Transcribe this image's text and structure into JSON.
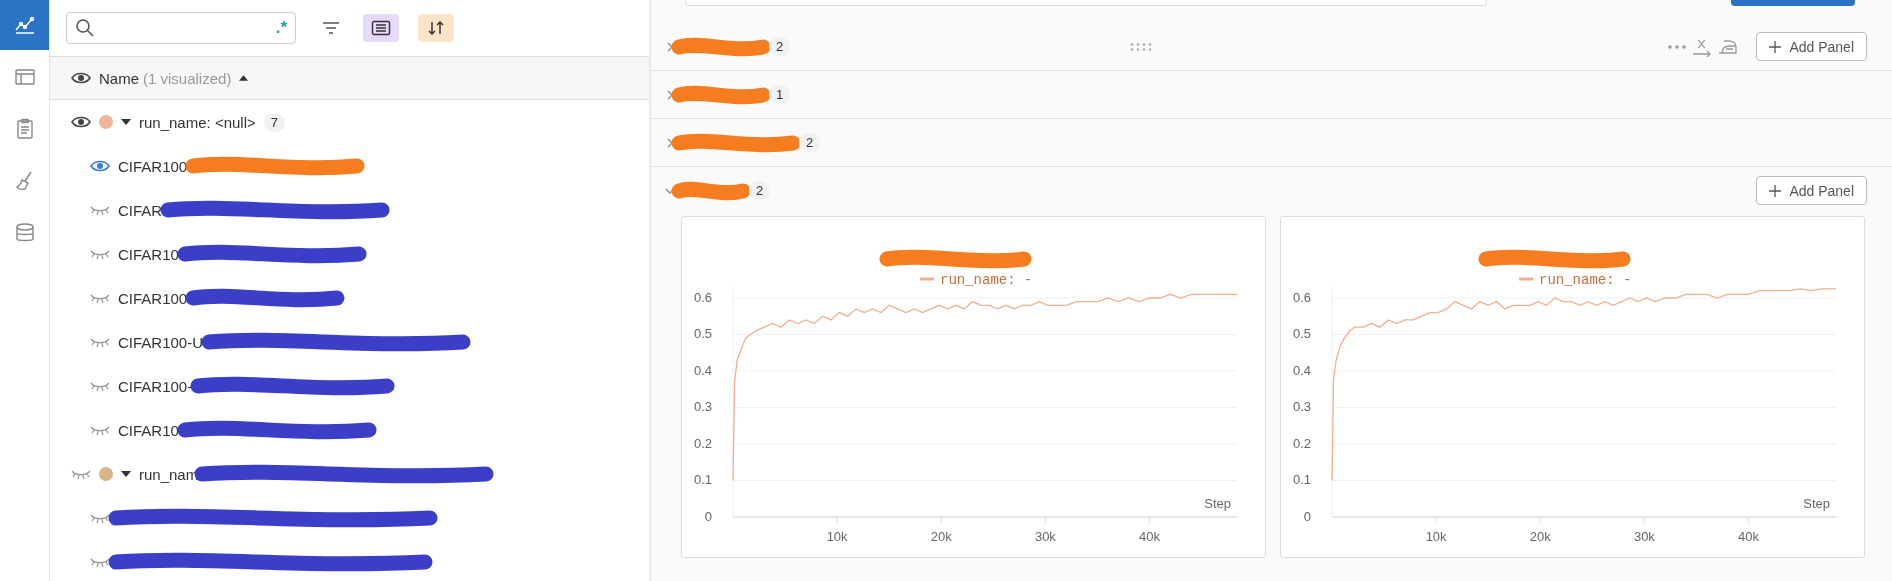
{
  "nav": [
    {
      "kind": "chart",
      "selected": true
    },
    {
      "kind": "table",
      "selected": false
    },
    {
      "kind": "report",
      "selected": false
    },
    {
      "kind": "sweep",
      "selected": false
    },
    {
      "kind": "artifact",
      "selected": false
    }
  ],
  "toolbar": {
    "regex_mark": ".*"
  },
  "runs_header": {
    "label": "Name",
    "note": "(1 visualized)"
  },
  "groups": [
    {
      "label": "run_name: <null>",
      "count": "7",
      "visible": true,
      "expanded": true,
      "color": "#f0b49a",
      "runs": [
        {
          "label": "CIFAR100",
          "visible": true,
          "scribble": {
            "color": "#f57c1f"
          }
        },
        {
          "label": "CIFAR",
          "visible": false,
          "scribble": {
            "color": "#3b3fc8"
          }
        },
        {
          "label": "CIFAR10",
          "visible": false,
          "scribble": {
            "color": "#3b3fc8"
          }
        },
        {
          "label": "CIFAR100",
          "visible": false,
          "scribble": {
            "color": "#3b3fc8"
          }
        },
        {
          "label": "CIFAR100-U",
          "visible": false,
          "scribble": {
            "color": "#3b3fc8"
          }
        },
        {
          "label": "CIFAR100-",
          "visible": false,
          "scribble": {
            "color": "#3b3fc8"
          }
        },
        {
          "label": "CIFAR10",
          "visible": false,
          "scribble": {
            "color": "#3b3fc8"
          }
        }
      ]
    },
    {
      "label": "run_nam",
      "visible": false,
      "expanded": true,
      "color": "#d9b48a",
      "scribble": {
        "color": "#3b3fc8"
      },
      "runs": [
        {
          "visible": false,
          "scribble": {
            "color": "#3b3fc8"
          }
        },
        {
          "visible": false,
          "scribble": {
            "color": "#3b3fc8"
          }
        }
      ]
    }
  ],
  "sections": [
    {
      "count": "2",
      "expanded": false,
      "hovered": true,
      "add_panel": "Add Panel",
      "scribble": {
        "color": "#f57c1f"
      }
    },
    {
      "count": "1",
      "expanded": false,
      "hovered": false,
      "scribble": {
        "color": "#f57c1f"
      }
    },
    {
      "count": "2",
      "expanded": false,
      "hovered": false,
      "scribble": {
        "color": "#f57c1f"
      }
    },
    {
      "count": "2",
      "expanded": true,
      "hovered": false,
      "add_panel": "Add Panel",
      "scribble": {
        "color": "#f57c1f"
      },
      "panels": [
        {
          "scribble": {
            "color": "#f57c1f"
          },
          "chart_data": {
            "type": "line",
            "xlabel": "Step",
            "x": [
              0,
              150,
              400,
              800,
              1200,
              1700,
              2200,
              3000,
              3800,
              4600,
              5400,
              6200,
              7000,
              7800,
              8600,
              9400,
              10200,
              11000,
              11800,
              12600,
              13400,
              14200,
              15000,
              15800,
              16600,
              17400,
              18200,
              19000,
              19800,
              20600,
              21400,
              22200,
              23000,
              23800,
              24600,
              25400,
              26200,
              27000,
              27800,
              28600,
              29400,
              30200,
              31000,
              32000,
              33000,
              34000,
              35000,
              36000,
              37000,
              38000,
              39000,
              40000,
              41000,
              42000,
              43000,
              44000,
              45000,
              46000,
              47000,
              48400
            ],
            "series": [
              {
                "name": "run_name: -",
                "color": "#f0b08f",
                "values": [
                  0.1,
                  0.37,
                  0.43,
                  0.46,
                  0.49,
                  0.5,
                  0.51,
                  0.52,
                  0.53,
                  0.52,
                  0.54,
                  0.53,
                  0.54,
                  0.53,
                  0.55,
                  0.54,
                  0.56,
                  0.55,
                  0.57,
                  0.56,
                  0.57,
                  0.56,
                  0.58,
                  0.57,
                  0.56,
                  0.57,
                  0.56,
                  0.57,
                  0.58,
                  0.57,
                  0.58,
                  0.57,
                  0.59,
                  0.58,
                  0.58,
                  0.57,
                  0.58,
                  0.57,
                  0.58,
                  0.58,
                  0.59,
                  0.58,
                  0.58,
                  0.58,
                  0.59,
                  0.59,
                  0.59,
                  0.6,
                  0.59,
                  0.6,
                  0.59,
                  0.6,
                  0.6,
                  0.61,
                  0.6,
                  0.61,
                  0.61,
                  0.61,
                  0.61,
                  0.61
                ]
              }
            ],
            "xlim": [
              0,
              48400
            ],
            "ylim": [
              0,
              0.63
            ],
            "grid": true,
            "yticks": [
              0,
              0.1,
              0.2,
              0.3,
              0.4,
              0.5,
              0.6
            ],
            "xticks": [
              {
                "value": 10000,
                "label": "10k"
              },
              {
                "value": 20000,
                "label": "20k"
              },
              {
                "value": 30000,
                "label": "30k"
              },
              {
                "value": 40000,
                "label": "40k"
              }
            ]
          }
        },
        {
          "scribble": {
            "color": "#f57c1f"
          },
          "chart_data": {
            "type": "line",
            "xlabel": "Step",
            "x": [
              0,
              150,
              400,
              800,
              1200,
              1700,
              2200,
              3000,
              3800,
              4600,
              5400,
              6200,
              7000,
              7800,
              8600,
              9400,
              10200,
              11000,
              11800,
              12600,
              13400,
              14200,
              15000,
              15800,
              16600,
              17400,
              18200,
              19000,
              19800,
              20600,
              21400,
              22200,
              23000,
              23800,
              24600,
              25400,
              26200,
              27000,
              27800,
              28600,
              29400,
              30200,
              31000,
              32000,
              33000,
              34000,
              35000,
              36000,
              37000,
              38000,
              39000,
              40000,
              41000,
              42000,
              43000,
              44000,
              45000,
              46000,
              47000,
              48400
            ],
            "series": [
              {
                "name": "run_name: -",
                "color": "#f0b08f",
                "values": [
                  0.1,
                  0.38,
                  0.43,
                  0.47,
                  0.49,
                  0.51,
                  0.52,
                  0.52,
                  0.53,
                  0.52,
                  0.54,
                  0.53,
                  0.54,
                  0.54,
                  0.55,
                  0.56,
                  0.56,
                  0.57,
                  0.59,
                  0.58,
                  0.57,
                  0.59,
                  0.58,
                  0.59,
                  0.57,
                  0.58,
                  0.58,
                  0.58,
                  0.59,
                  0.58,
                  0.6,
                  0.59,
                  0.59,
                  0.58,
                  0.59,
                  0.58,
                  0.59,
                  0.58,
                  0.59,
                  0.6,
                  0.59,
                  0.6,
                  0.59,
                  0.6,
                  0.6,
                  0.61,
                  0.61,
                  0.61,
                  0.6,
                  0.61,
                  0.61,
                  0.61,
                  0.62,
                  0.62,
                  0.62,
                  0.62,
                  0.625,
                  0.62,
                  0.625,
                  0.625
                ]
              }
            ],
            "xlim": [
              0,
              48400
            ],
            "ylim": [
              0,
              0.63
            ],
            "grid": true,
            "yticks": [
              0,
              0.1,
              0.2,
              0.3,
              0.4,
              0.5,
              0.6
            ],
            "xticks": [
              {
                "value": 10000,
                "label": "10k"
              },
              {
                "value": 20000,
                "label": "20k"
              },
              {
                "value": 30000,
                "label": "30k"
              },
              {
                "value": 40000,
                "label": "40k"
              }
            ]
          }
        }
      ]
    }
  ]
}
